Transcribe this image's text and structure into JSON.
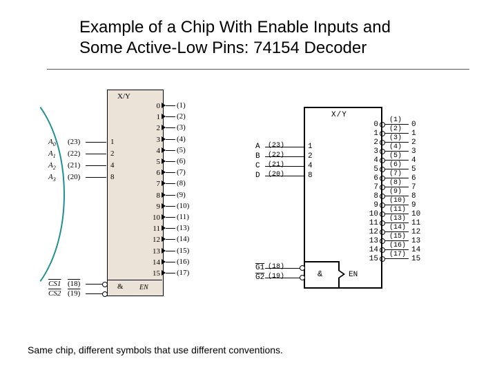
{
  "title_line1": "Example of a Chip With Enable Inputs and",
  "title_line2": "Some Active-Low Pins: 74154 Decoder",
  "caption": "Same chip, different symbols that use different conventions.",
  "left": {
    "header": "X/Y",
    "and_symbol": "&",
    "enable_label": "EN",
    "outputs": [
      {
        "n": "0",
        "pin": "(1)"
      },
      {
        "n": "1",
        "pin": "(2)"
      },
      {
        "n": "2",
        "pin": "(3)"
      },
      {
        "n": "3",
        "pin": "(4)"
      },
      {
        "n": "4",
        "pin": "(5)"
      },
      {
        "n": "5",
        "pin": "(6)"
      },
      {
        "n": "6",
        "pin": "(7)"
      },
      {
        "n": "7",
        "pin": "(8)"
      },
      {
        "n": "8",
        "pin": "(9)"
      },
      {
        "n": "9",
        "pin": "(10)"
      },
      {
        "n": "10",
        "pin": "(11)"
      },
      {
        "n": "11",
        "pin": "(13)"
      },
      {
        "n": "12",
        "pin": "(14)"
      },
      {
        "n": "13",
        "pin": "(15)"
      },
      {
        "n": "14",
        "pin": "(16)"
      },
      {
        "n": "15",
        "pin": "(17)"
      }
    ],
    "address_inputs": [
      {
        "label": "A0",
        "pin": "(23)",
        "val": "1"
      },
      {
        "label": "A1",
        "pin": "(22)",
        "val": "2"
      },
      {
        "label": "A2",
        "pin": "(21)",
        "val": "4"
      },
      {
        "label": "A3",
        "pin": "(20)",
        "val": "8"
      }
    ],
    "enable_inputs": [
      {
        "label": "CS1",
        "pin": "(18)"
      },
      {
        "label": "CS2",
        "pin": "(19)"
      }
    ]
  },
  "right": {
    "header": "X/Y",
    "and_symbol": "&",
    "enable_label": "EN",
    "outputs": [
      {
        "n": "0",
        "pin": "(1)"
      },
      {
        "n": "1",
        "pin": "(2)"
      },
      {
        "n": "2",
        "pin": "(3)"
      },
      {
        "n": "3",
        "pin": "(4)"
      },
      {
        "n": "4",
        "pin": "(5)"
      },
      {
        "n": "5",
        "pin": "(6)"
      },
      {
        "n": "6",
        "pin": "(7)"
      },
      {
        "n": "7",
        "pin": "(8)"
      },
      {
        "n": "8",
        "pin": "(9)"
      },
      {
        "n": "9",
        "pin": "(10)"
      },
      {
        "n": "10",
        "pin": "(11)"
      },
      {
        "n": "11",
        "pin": "(13)"
      },
      {
        "n": "12",
        "pin": "(14)"
      },
      {
        "n": "13",
        "pin": "(15)"
      },
      {
        "n": "14",
        "pin": "(16)"
      },
      {
        "n": "15",
        "pin": "(17)"
      }
    ],
    "address_inputs": [
      {
        "label": "A",
        "pin": "(23)",
        "val": "1"
      },
      {
        "label": "B",
        "pin": "(22)",
        "val": "2"
      },
      {
        "label": "C",
        "pin": "(21)",
        "val": "4"
      },
      {
        "label": "D",
        "pin": "(20)",
        "val": "8"
      }
    ],
    "enable_inputs": [
      {
        "label": "G1",
        "pin": "(18)"
      },
      {
        "label": "G2",
        "pin": "(19)"
      }
    ]
  }
}
